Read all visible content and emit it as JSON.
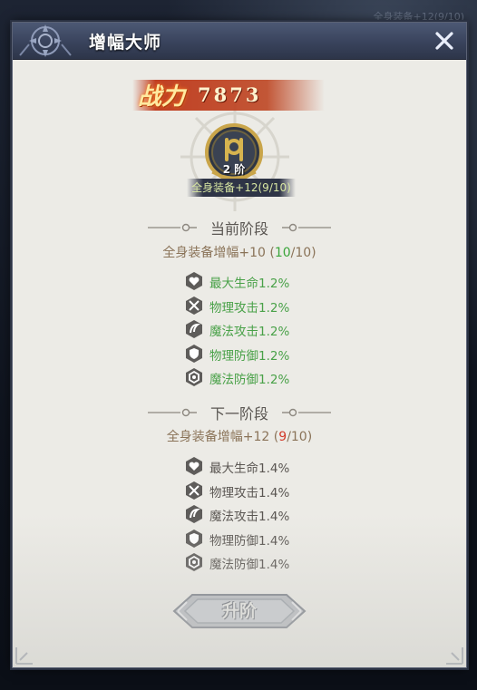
{
  "background": {
    "corner_text": "全身装备+12(9/10)"
  },
  "window": {
    "title": "增幅大师"
  },
  "power": {
    "label": "战力",
    "value": "7873"
  },
  "badge": {
    "tier": "2 阶",
    "caption": "全身装备+12(9/10)"
  },
  "current_stage": {
    "title": "当前阶段",
    "summary_prefix": "全身装备增幅+10 (",
    "progress_current": "10",
    "progress_sep": "/10)",
    "stats": [
      {
        "icon": "heart-icon",
        "label": "最大生命1.2%"
      },
      {
        "icon": "swords-icon",
        "label": "物理攻击1.2%"
      },
      {
        "icon": "magic-swirl-icon",
        "label": "魔法攻击1.2%"
      },
      {
        "icon": "shield-icon",
        "label": "物理防御1.2%"
      },
      {
        "icon": "magic-shield-icon",
        "label": "魔法防御1.2%"
      }
    ]
  },
  "next_stage": {
    "title": "下一阶段",
    "summary_prefix": "全身装备增幅+12 (",
    "progress_current": "9",
    "progress_sep": "/10)",
    "stats": [
      {
        "icon": "heart-icon",
        "label": "最大生命1.4%"
      },
      {
        "icon": "swords-icon",
        "label": "物理攻击1.4%"
      },
      {
        "icon": "magic-swirl-icon",
        "label": "魔法攻击1.4%"
      },
      {
        "icon": "shield-icon",
        "label": "物理防御1.4%"
      },
      {
        "icon": "magic-shield-icon",
        "label": "魔法防御1.4%"
      }
    ]
  },
  "actions": {
    "upgrade_label": "升阶"
  },
  "colors": {
    "positive": "#49a148",
    "insufficient": "#d33a2a",
    "title_bar": "#3d4760"
  }
}
